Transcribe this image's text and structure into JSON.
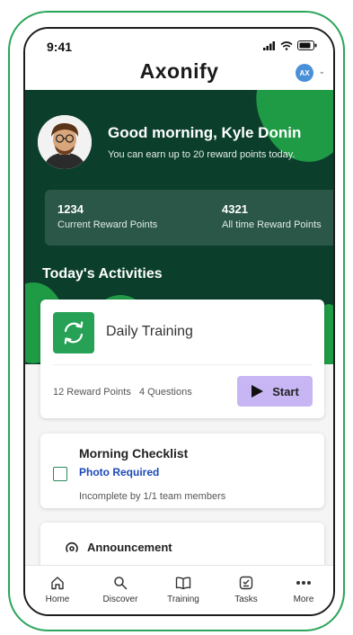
{
  "status_bar": {
    "time": "9:41"
  },
  "app": {
    "logo": "Axonify",
    "avatar_initials": "AX"
  },
  "hero": {
    "greeting": "Good morning, Kyle Donin",
    "subtitle": "You can earn up to 20 reward points today."
  },
  "points": [
    {
      "value": "1234",
      "label": "Current Reward Points"
    },
    {
      "value": "4321",
      "label": "All time Reward Points"
    }
  ],
  "section_title": "Today's Activities",
  "training": {
    "title": "Daily Training",
    "reward": "12 Reward Points",
    "questions": "4 Questions",
    "start_label": "Start"
  },
  "checklist": {
    "title": "Morning Checklist",
    "requirement": "Photo Required",
    "status": "Incomplete by 1/1 team members"
  },
  "announcement": {
    "title": "Announcement"
  },
  "tabs": [
    {
      "label": "Home",
      "icon": "home-icon"
    },
    {
      "label": "Discover",
      "icon": "search-icon"
    },
    {
      "label": "Training",
      "icon": "book-icon"
    },
    {
      "label": "Tasks",
      "icon": "tasks-icon"
    },
    {
      "label": "More",
      "icon": "more-icon"
    }
  ],
  "colors": {
    "brand_green": "#26a155",
    "dark_green": "#0b3f2c",
    "start_button": "#c7b6f3",
    "link_blue": "#1d49b8",
    "frame": "#2aa55a"
  }
}
